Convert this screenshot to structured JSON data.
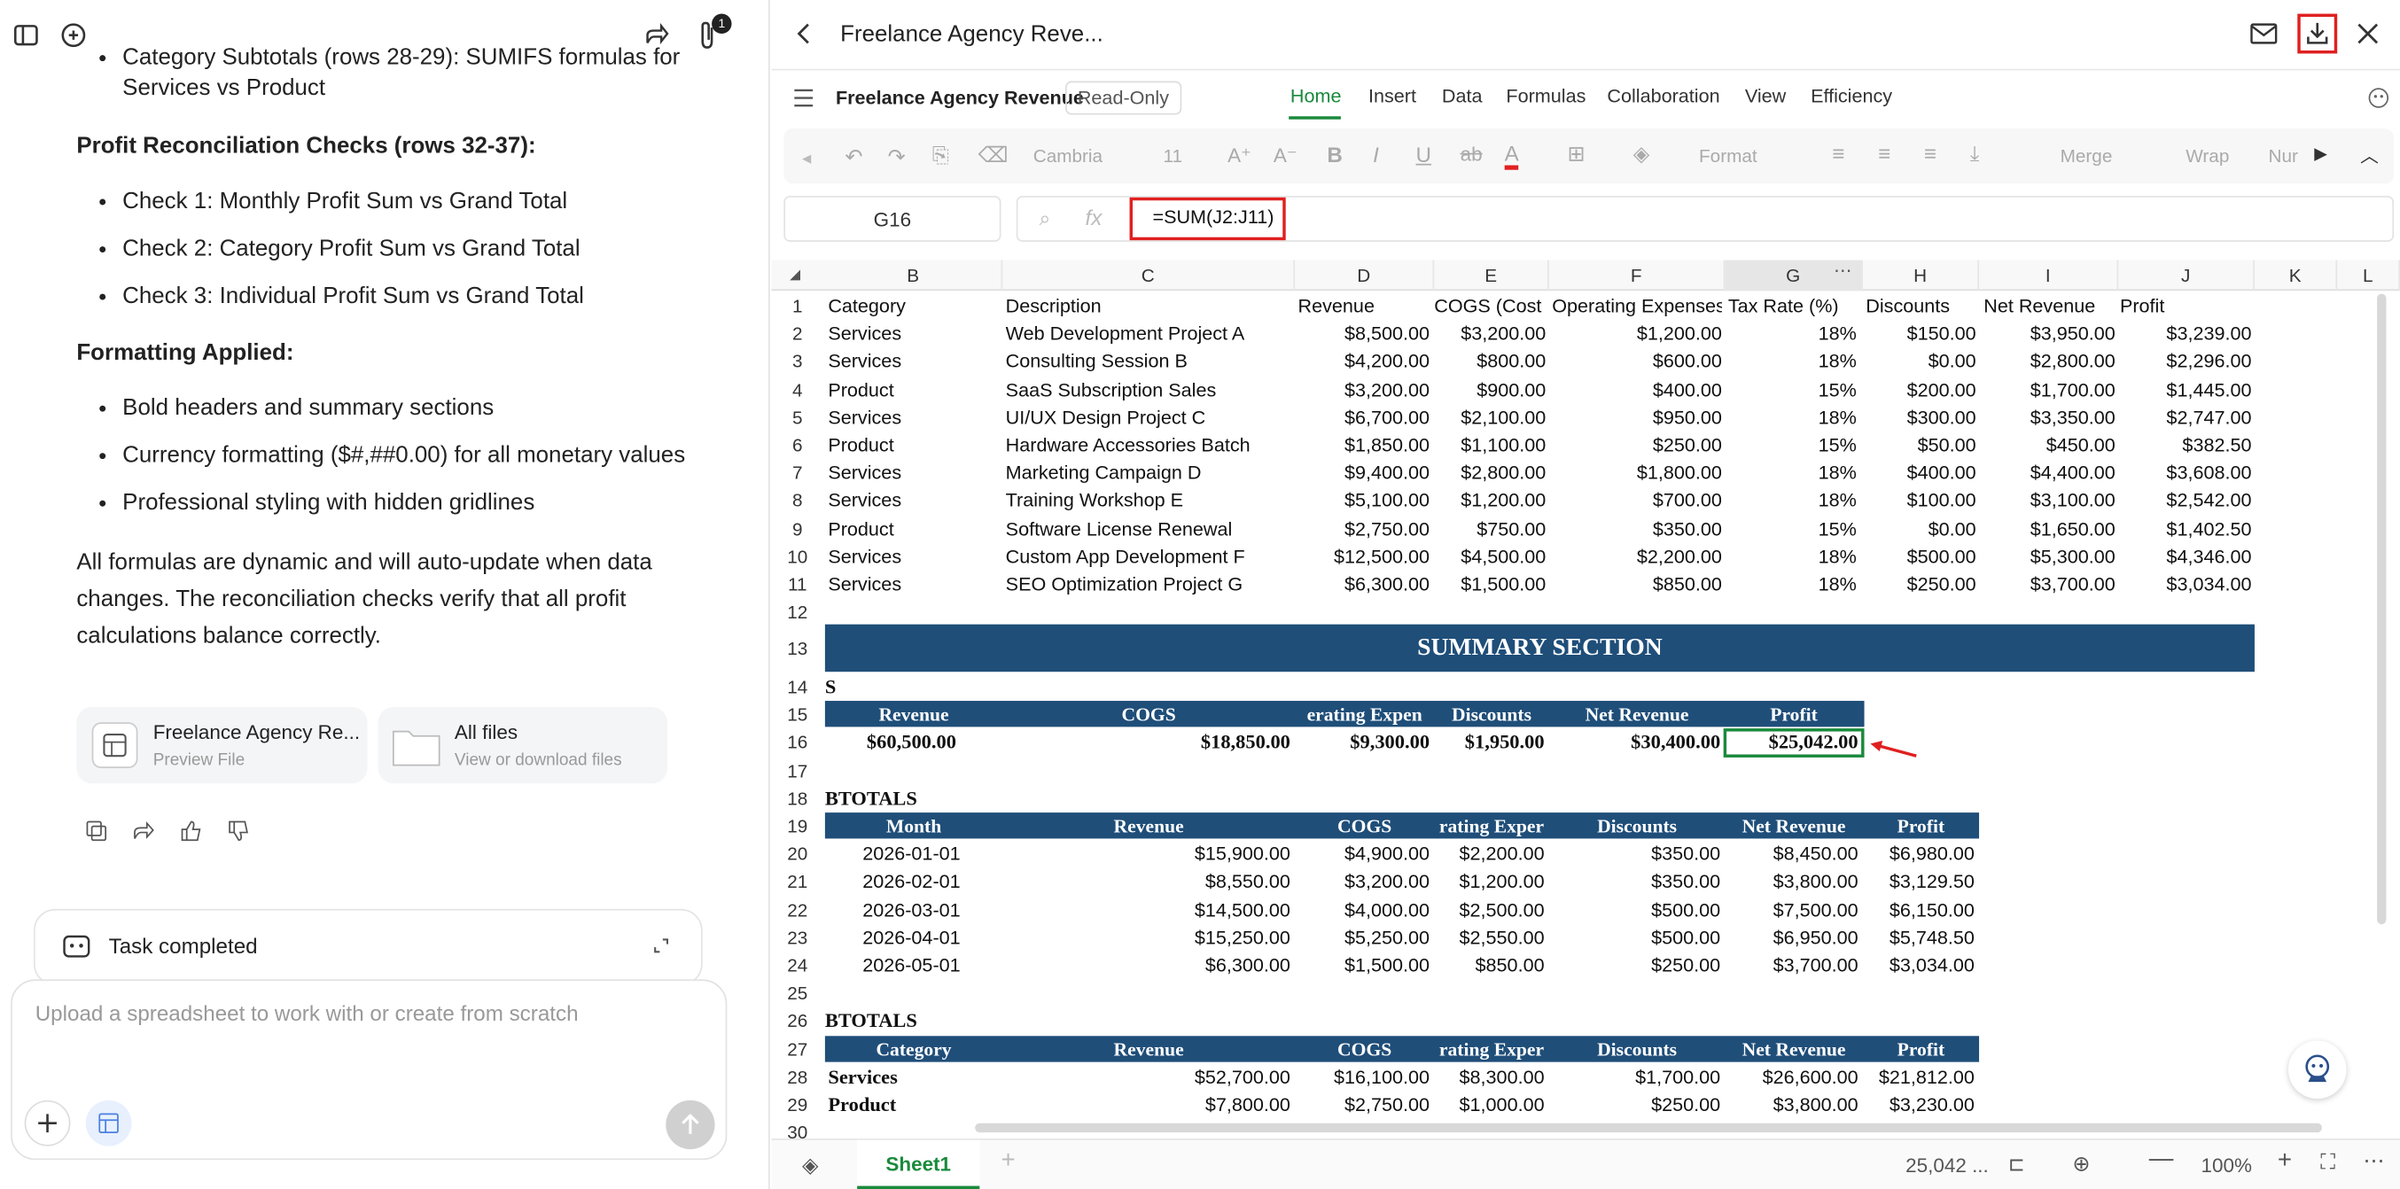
{
  "chat": {
    "bullet0": "Category Subtotals (rows 28-29): SUMIFS formulas for Services vs Product",
    "h1": "Profit Reconciliation Checks (rows 32-37):",
    "list1": [
      "Check 1: Monthly Profit Sum vs Grand Total",
      "Check 2: Category Profit Sum vs Grand Total",
      "Check 3: Individual Profit Sum vs Grand Total"
    ],
    "h2": "Formatting Applied:",
    "list2": [
      "Bold headers and summary sections",
      "Currency formatting ($#,##0.00) for all monetary values",
      "Professional styling with hidden gridlines"
    ],
    "para": "All formulas are dynamic and will auto-update when data changes. The reconciliation checks verify that all profit calculations balance correctly.",
    "file1_name": "Freelance Agency Re...",
    "file1_sub": "Preview File",
    "file2_name": "All files",
    "file2_sub": "View or download files",
    "task_status": "Task completed",
    "input_placeholder": "Upload a spreadsheet to work with or create from scratch",
    "attach_badge": "1"
  },
  "sheet": {
    "title": "Freelance Agency Reve...",
    "doc_name": "Freelance Agency Revenue",
    "readonly": "Read-Only",
    "menu": [
      "Home",
      "Insert",
      "Data",
      "Formulas",
      "Collaboration",
      "View",
      "Efficiency"
    ],
    "font": "Cambria",
    "size": "11",
    "format": "Format",
    "merge": "Merge",
    "wrap": "Wrap",
    "num": "Nur",
    "cell_ref": "G16",
    "formula": "=SUM(J2:J11)",
    "columns": [
      "B",
      "C",
      "D",
      "E",
      "F",
      "G",
      "H",
      "I",
      "J",
      "K",
      "L"
    ],
    "rows": [
      "1",
      "2",
      "3",
      "4",
      "5",
      "6",
      "7",
      "8",
      "9",
      "10",
      "11",
      "12",
      "13",
      "14",
      "15",
      "16",
      "17",
      "18",
      "19",
      "20",
      "21",
      "22",
      "23",
      "24",
      "25",
      "26",
      "27",
      "28",
      "29",
      "30"
    ],
    "header": [
      "Category",
      "Description",
      "Revenue",
      "COGS (Cost o",
      "Operating Expenses",
      "Tax Rate (%)",
      "Discounts",
      "Net Revenue",
      "Profit"
    ],
    "data": [
      [
        "Services",
        "Web Development Project A",
        "$8,500.00",
        "$3,200.00",
        "$1,200.00",
        "18%",
        "$150.00",
        "$3,950.00",
        "$3,239.00"
      ],
      [
        "Services",
        "Consulting Session B",
        "$4,200.00",
        "$800.00",
        "$600.00",
        "18%",
        "$0.00",
        "$2,800.00",
        "$2,296.00"
      ],
      [
        "Product",
        "SaaS Subscription Sales",
        "$3,200.00",
        "$900.00",
        "$400.00",
        "15%",
        "$200.00",
        "$1,700.00",
        "$1,445.00"
      ],
      [
        "Services",
        "UI/UX Design Project C",
        "$6,700.00",
        "$2,100.00",
        "$950.00",
        "18%",
        "$300.00",
        "$3,350.00",
        "$2,747.00"
      ],
      [
        "Product",
        "Hardware Accessories Batch",
        "$1,850.00",
        "$1,100.00",
        "$250.00",
        "15%",
        "$50.00",
        "$450.00",
        "$382.50"
      ],
      [
        "Services",
        "Marketing Campaign D",
        "$9,400.00",
        "$2,800.00",
        "$1,800.00",
        "18%",
        "$400.00",
        "$4,400.00",
        "$3,608.00"
      ],
      [
        "Services",
        "Training Workshop E",
        "$5,100.00",
        "$1,200.00",
        "$700.00",
        "18%",
        "$100.00",
        "$3,100.00",
        "$2,542.00"
      ],
      [
        "Product",
        "Software License Renewal",
        "$2,750.00",
        "$750.00",
        "$350.00",
        "15%",
        "$0.00",
        "$1,650.00",
        "$1,402.50"
      ],
      [
        "Services",
        "Custom App Development F",
        "$12,500.00",
        "$4,500.00",
        "$2,200.00",
        "18%",
        "$500.00",
        "$5,300.00",
        "$4,346.00"
      ],
      [
        "Services",
        "SEO Optimization Project G",
        "$6,300.00",
        "$1,500.00",
        "$850.00",
        "18%",
        "$250.00",
        "$3,700.00",
        "$3,034.00"
      ]
    ],
    "summary_title": "SUMMARY SECTION",
    "s14": "S",
    "sum_hdr": [
      "Revenue",
      "COGS",
      "erating Expen",
      "Discounts",
      "Net Revenue",
      "Profit"
    ],
    "sum_vals": [
      "$60,500.00",
      "$18,850.00",
      "$9,300.00",
      "$1,950.00",
      "$30,400.00",
      "$25,042.00"
    ],
    "s18": "BTOTALS",
    "month_hdr": [
      "Month",
      "Revenue",
      "COGS",
      "rating Exper",
      "Discounts",
      "Net Revenue",
      "Profit"
    ],
    "months": [
      [
        "2026-01-01",
        "$15,900.00",
        "$4,900.00",
        "$2,200.00",
        "$350.00",
        "$8,450.00",
        "$6,980.00"
      ],
      [
        "2026-02-01",
        "$8,550.00",
        "$3,200.00",
        "$1,200.00",
        "$350.00",
        "$3,800.00",
        "$3,129.50"
      ],
      [
        "2026-03-01",
        "$14,500.00",
        "$4,000.00",
        "$2,500.00",
        "$500.00",
        "$7,500.00",
        "$6,150.00"
      ],
      [
        "2026-04-01",
        "$15,250.00",
        "$5,250.00",
        "$2,550.00",
        "$500.00",
        "$6,950.00",
        "$5,748.50"
      ],
      [
        "2026-05-01",
        "$6,300.00",
        "$1,500.00",
        "$850.00",
        "$250.00",
        "$3,700.00",
        "$3,034.00"
      ]
    ],
    "s26": "BTOTALS",
    "cat_hdr": [
      "Category",
      "Revenue",
      "COGS",
      "rating Exper",
      "Discounts",
      "Net Revenue",
      "Profit"
    ],
    "cats": [
      [
        "Services",
        "$52,700.00",
        "$16,100.00",
        "$8,300.00",
        "$1,700.00",
        "$26,600.00",
        "$21,812.00"
      ],
      [
        "Product",
        "$7,800.00",
        "$2,750.00",
        "$1,000.00",
        "$250.00",
        "$3,800.00",
        "$3,230.00"
      ]
    ],
    "tab": "Sheet1",
    "status_value": "25,042 ...",
    "zoom": "100%"
  },
  "colors": {
    "header_blue": "#1f4e79",
    "accent_green": "#1a8a3c",
    "highlight_red": "#e02020"
  }
}
